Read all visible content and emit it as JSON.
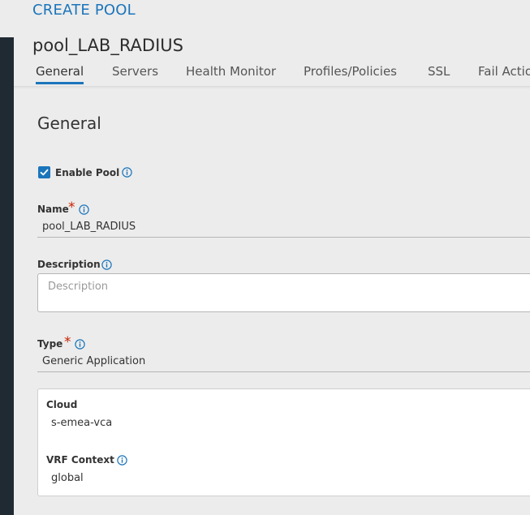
{
  "header": {
    "title": "CREATE POOL",
    "object_name": "pool_LAB_RADIUS"
  },
  "tabs": [
    {
      "label": "General",
      "active": true
    },
    {
      "label": "Servers",
      "active": false
    },
    {
      "label": "Health Monitor",
      "active": false
    },
    {
      "label": "Profiles/Policies",
      "active": false
    },
    {
      "label": "SSL",
      "active": false
    },
    {
      "label": "Fail Actio",
      "active": false
    }
  ],
  "section": {
    "title": "General"
  },
  "enable_pool": {
    "label": "Enable Pool",
    "checked": true
  },
  "name_field": {
    "label": "Name",
    "required_mark": "*",
    "value": "pool_LAB_RADIUS"
  },
  "description_field": {
    "label": "Description",
    "placeholder": "Description",
    "value": ""
  },
  "type_field": {
    "label": "Type",
    "required_mark": "*",
    "value": "Generic Application"
  },
  "cloud_field": {
    "label": "Cloud",
    "value": "s-emea-vca"
  },
  "vrf_field": {
    "label": "VRF Context",
    "value": "global"
  },
  "icons": {
    "checkbox": "checkmark-icon",
    "info": "info-circle-icon"
  },
  "colors": {
    "accent": "#1b75bb",
    "required": "#c92100",
    "sidebar": "#1f2a33"
  }
}
